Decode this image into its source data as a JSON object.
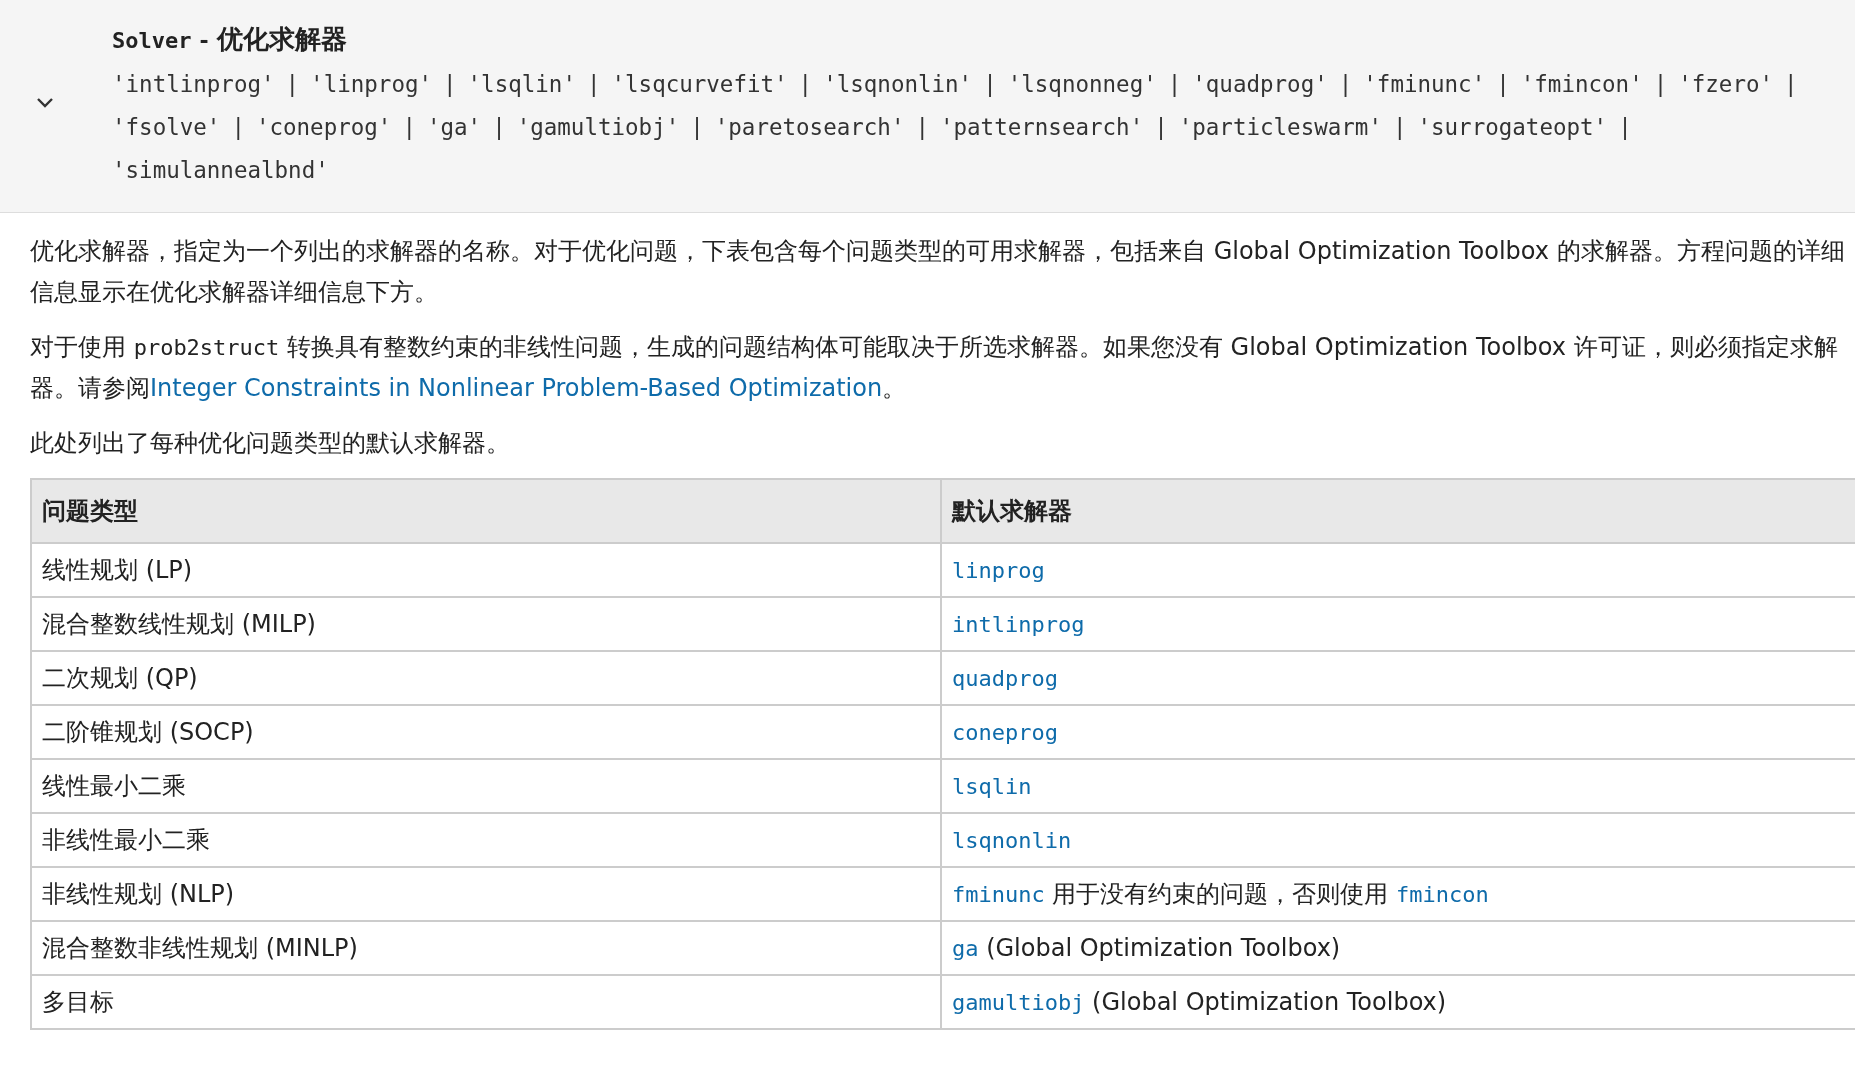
{
  "option_header": {
    "expanded": true,
    "name": "Solver",
    "dash": "-",
    "title": "优化求解器",
    "separator": "|",
    "values": [
      "'intlinprog'",
      "'linprog'",
      "'lsqlin'",
      "'lsqcurvefit'",
      "'lsqnonlin'",
      "'lsqnonneg'",
      "'quadprog'",
      "'fminunc'",
      "'fmincon'",
      "'fzero'",
      "'fsolve'",
      "'coneprog'",
      "'ga'",
      "'gamultiobj'",
      "'paretosearch'",
      "'patternsearch'",
      "'particleswarm'",
      "'surrogateopt'",
      "'simulannealbnd'"
    ]
  },
  "paragraphs": [
    [
      {
        "kind": "text",
        "text": "优化求解器，指定为一个列出的求解器的名称。对于优化问题，下表包含每个问题类型的可用求解器，包括来自 Global Optimization Toolbox 的求解器。方程问题的详细信息显示在优化求解器详细信息下方。"
      }
    ],
    [
      {
        "kind": "text",
        "text": "对于使用 "
      },
      {
        "kind": "code",
        "text": "prob2struct"
      },
      {
        "kind": "text",
        "text": " 转换具有整数约束的非线性问题，生成的问题结构体可能取决于所选求解器。如果您没有 Global Optimization Toolbox 许可证，则必须指定求解器。请参阅"
      },
      {
        "kind": "link",
        "text": "Integer Constraints in Nonlinear Problem-Based Optimization"
      },
      {
        "kind": "text",
        "text": "。"
      }
    ],
    [
      {
        "kind": "text",
        "text": "此处列出了每种优化问题类型的默认求解器。"
      }
    ]
  ],
  "table": {
    "columns": [
      "问题类型",
      "默认求解器"
    ],
    "rows": [
      {
        "problem": "线性规划 (LP)",
        "solver": [
          {
            "kind": "link",
            "text": "linprog"
          }
        ]
      },
      {
        "problem": "混合整数线性规划 (MILP)",
        "solver": [
          {
            "kind": "link",
            "text": "intlinprog"
          }
        ]
      },
      {
        "problem": "二次规划 (QP)",
        "solver": [
          {
            "kind": "link",
            "text": "quadprog"
          }
        ]
      },
      {
        "problem": "二阶锥规划 (SOCP)",
        "solver": [
          {
            "kind": "link",
            "text": "coneprog"
          }
        ]
      },
      {
        "problem": "线性最小二乘",
        "solver": [
          {
            "kind": "link",
            "text": "lsqlin"
          }
        ]
      },
      {
        "problem": "非线性最小二乘",
        "solver": [
          {
            "kind": "link",
            "text": "lsqnonlin"
          }
        ]
      },
      {
        "problem": "非线性规划 (NLP)",
        "solver": [
          {
            "kind": "link",
            "text": "fminunc"
          },
          {
            "kind": "text",
            "text": " 用于没有约束的问题，否则使用 "
          },
          {
            "kind": "link",
            "text": "fmincon"
          }
        ]
      },
      {
        "problem": "混合整数非线性规划 (MINLP)",
        "solver": [
          {
            "kind": "link",
            "text": "ga"
          },
          {
            "kind": "text",
            "text": " (Global Optimization Toolbox)"
          }
        ]
      },
      {
        "problem": "多目标",
        "solver": [
          {
            "kind": "link",
            "text": "gamultiobj"
          },
          {
            "kind": "text",
            "text": " (Global Optimization Toolbox)"
          }
        ]
      }
    ]
  }
}
